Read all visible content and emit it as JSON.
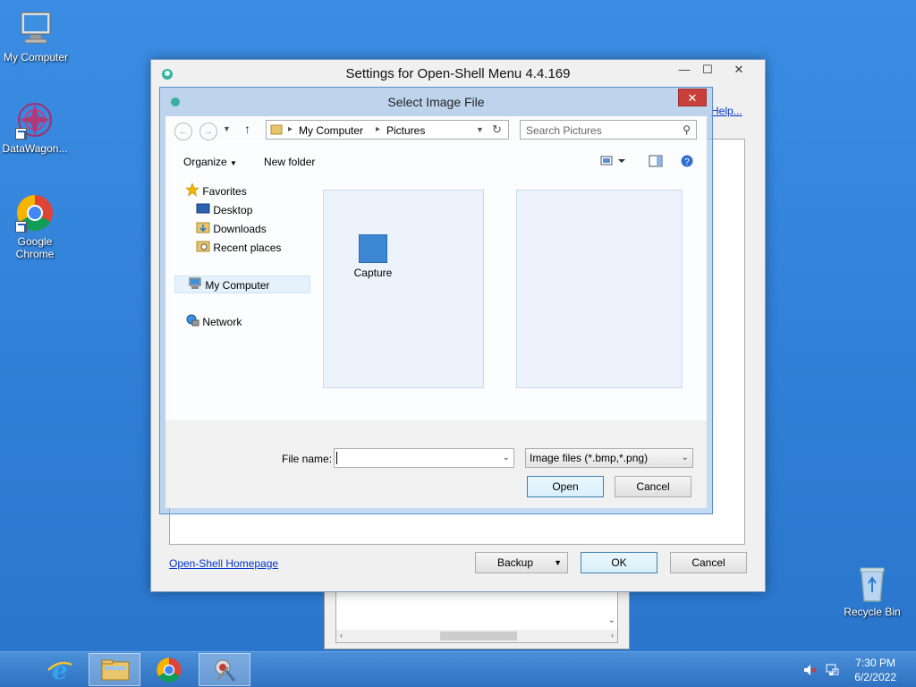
{
  "desktop": {
    "icons": [
      {
        "label": "My Computer"
      },
      {
        "label": "DataWagon..."
      },
      {
        "label": "Google Chrome"
      },
      {
        "label": "Recycle Bin"
      }
    ]
  },
  "settings": {
    "title": "Settings for Open-Shell Menu 4.4.169",
    "help_link": "Help...",
    "homepage_link": "Open-Shell Homepage",
    "backup_label": "Backup",
    "ok_label": "OK",
    "cancel_label": "Cancel"
  },
  "dialog": {
    "title": "Select Image File",
    "breadcrumb": [
      "My Computer",
      "Pictures"
    ],
    "search_placeholder": "Search Pictures",
    "organize_label": "Organize",
    "new_folder_label": "New folder",
    "tree": {
      "favorites": "Favorites",
      "desktop": "Desktop",
      "downloads": "Downloads",
      "recent": "Recent places",
      "my_computer": "My Computer",
      "network": "Network"
    },
    "folder_item": "Capture",
    "file_name_label": "File name:",
    "file_name_value": "",
    "file_type": "Image files (*.bmp,*.png)",
    "open_label": "Open",
    "cancel_label": "Cancel"
  },
  "taskbar": {
    "time": "7:30 PM",
    "date": "6/2/2022"
  },
  "colors": {
    "desktop": "#2f7fd6",
    "close_red": "#c7403a",
    "link": "#0033cc"
  }
}
